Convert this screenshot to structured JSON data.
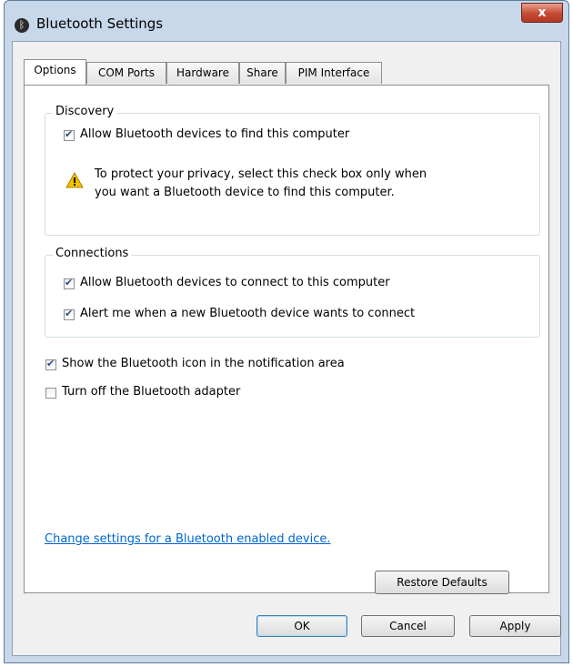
{
  "window": {
    "title": "Bluetooth Settings",
    "close_glyph": "x"
  },
  "tabs": [
    {
      "label": "Options"
    },
    {
      "label": "COM Ports"
    },
    {
      "label": "Hardware"
    },
    {
      "label": "Share"
    },
    {
      "label": "PIM Interface"
    }
  ],
  "discovery": {
    "legend": "Discovery",
    "allow_find": {
      "label": "Allow Bluetooth devices to find this computer",
      "checked": true
    },
    "warning_line1": "To protect your privacy, select this check box only when",
    "warning_line2": "you want a Bluetooth device to find this computer."
  },
  "connections": {
    "legend": "Connections",
    "allow_connect": {
      "label": "Allow Bluetooth devices to connect to this computer",
      "checked": true
    },
    "alert_new": {
      "label": "Alert me when a new Bluetooth device wants to connect",
      "checked": true
    }
  },
  "show_icon": {
    "label": "Show the Bluetooth icon in the notification area",
    "checked": true
  },
  "turn_off": {
    "label": "Turn off the Bluetooth adapter",
    "checked": false
  },
  "link_text": "Change settings for a Bluetooth enabled device.",
  "buttons": {
    "restore": "Restore Defaults",
    "ok": "OK",
    "cancel": "Cancel",
    "apply": "Apply"
  },
  "colors": {
    "warning": "#f2c200",
    "link": "#0066cc",
    "close": "#c44a33"
  }
}
